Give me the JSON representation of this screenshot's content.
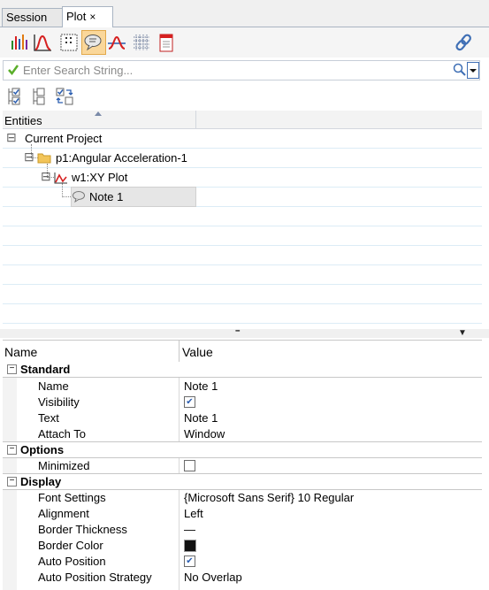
{
  "tabs": [
    {
      "label": "Session"
    },
    {
      "label": "Plot",
      "close": "×"
    }
  ],
  "toolbar_icons": [
    "bar-chart-icon",
    "curve-icon",
    "data-grid-icon",
    "note-icon",
    "datum-line-icon",
    "grid-lines-icon",
    "document-icon",
    "link-icon"
  ],
  "search": {
    "placeholder": "Enter Search String..."
  },
  "tree": {
    "header": "Entities",
    "nodes": [
      {
        "label": "Current Project",
        "toggle": "⊟"
      },
      {
        "label": "p1:Angular Acceleration-1",
        "toggle": "⊟"
      },
      {
        "label": "w1:XY Plot",
        "toggle": "⊟"
      },
      {
        "label": "Note 1"
      }
    ]
  },
  "splitter": {
    "grip": "▪▪▪",
    "arrow": "▼"
  },
  "properties": {
    "col_name": "Name",
    "col_value": "Value",
    "sections": {
      "standard": {
        "title": "Standard",
        "toggle": "−"
      },
      "options": {
        "title": "Options",
        "toggle": "−"
      },
      "display": {
        "title": "Display",
        "toggle": "−"
      }
    },
    "rows": {
      "name": {
        "k": "Name",
        "v": "Note 1"
      },
      "visibility": {
        "k": "Visibility",
        "checked": true
      },
      "text": {
        "k": "Text",
        "v": "Note 1"
      },
      "attach_to": {
        "k": "Attach To",
        "v": "Window"
      },
      "minimized": {
        "k": "Minimized",
        "checked": false
      },
      "font_settings": {
        "k": "Font Settings",
        "v": "{Microsoft Sans Serif} 10 Regular"
      },
      "alignment": {
        "k": "Alignment",
        "v": "Left"
      },
      "border_thickness": {
        "k": "Border Thickness",
        "v": "—"
      },
      "border_color": {
        "k": "Border Color",
        "swatch": "#111111"
      },
      "auto_position": {
        "k": "Auto Position",
        "checked": true
      },
      "auto_position_strategy": {
        "k": "Auto Position Strategy",
        "v": "No Overlap"
      }
    },
    "check_mark": "✔"
  },
  "colors": {
    "accent": "#fad79a",
    "grid_line": "#dcecf6",
    "link": "#2a5db0"
  }
}
